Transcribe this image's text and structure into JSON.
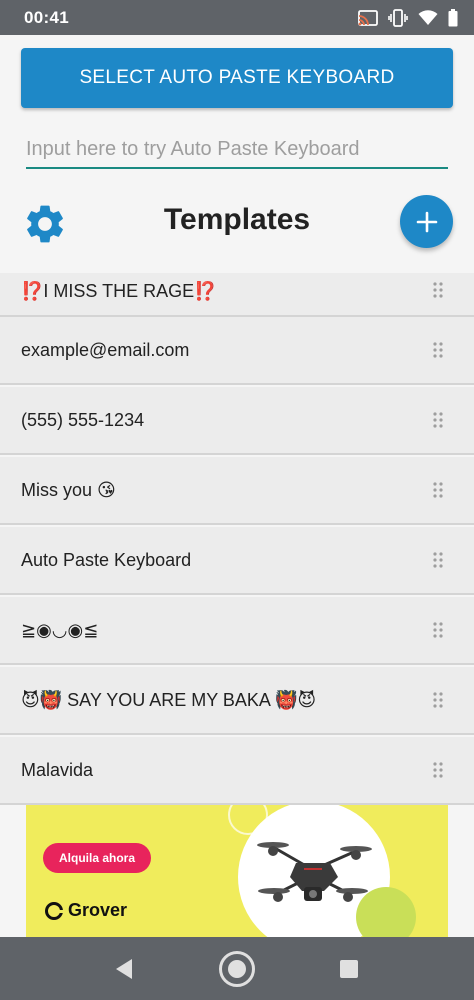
{
  "status_bar": {
    "time": "00:41"
  },
  "select_button": {
    "label": "SELECT AUTO PASTE KEYBOARD"
  },
  "try_input": {
    "placeholder": "Input here to try Auto Paste Keyboard",
    "value": ""
  },
  "header": {
    "title": "Templates",
    "settings_icon": "gear-icon",
    "add_icon": "plus-icon"
  },
  "templates": [
    {
      "text": "⁉️I MISS THE RAGE⁉️"
    },
    {
      "text": "example@email.com"
    },
    {
      "text": "(555) 555-1234"
    },
    {
      "text": "Miss you 😘"
    },
    {
      "text": "Auto Paste Keyboard"
    },
    {
      "text": "≧◉◡◉≦"
    },
    {
      "text": "😈👹 SAY YOU ARE MY BAKA 👹😈"
    },
    {
      "text": "Malavida"
    }
  ],
  "ad": {
    "button_label": "Alquila ahora",
    "brand": "Grover"
  },
  "colors": {
    "primary": "#1e88c7",
    "accent_line": "#1a8a82",
    "ad_bg": "#f0ec5c",
    "ad_button": "#e8245c"
  }
}
